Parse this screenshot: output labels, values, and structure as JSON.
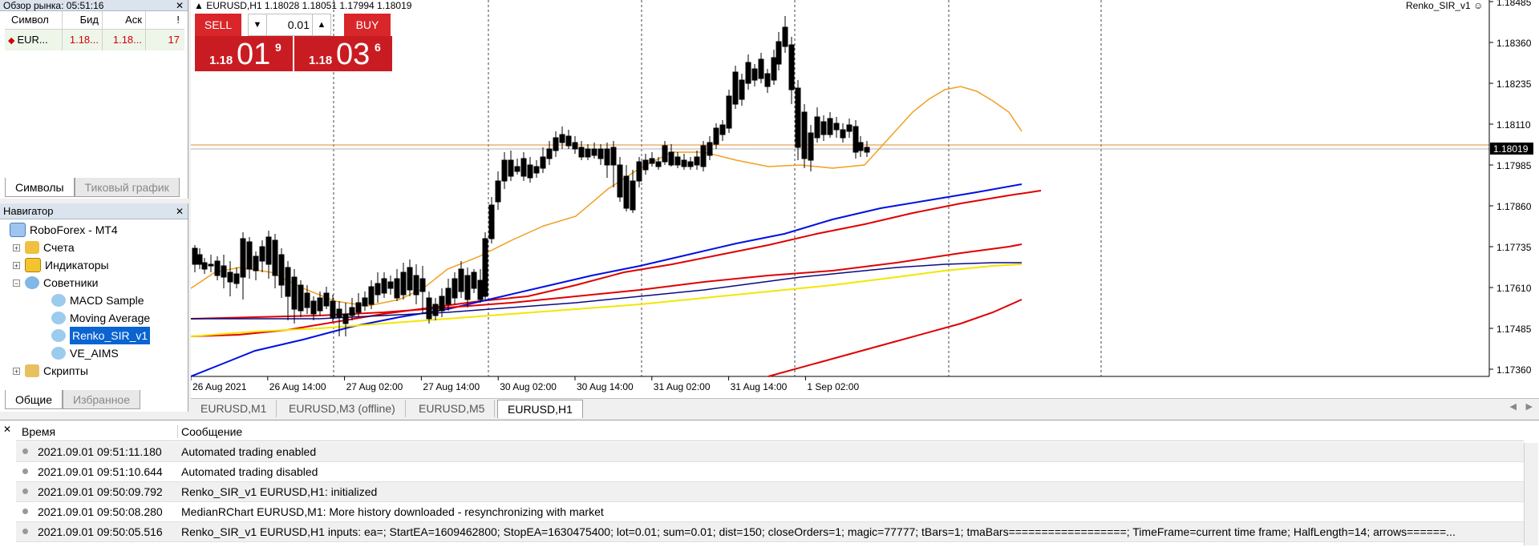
{
  "market_watch": {
    "title": "Обзор рынка: 05:51:16",
    "columns": [
      "Символ",
      "Бид",
      "Аск",
      "!"
    ],
    "rows": [
      {
        "symbol": "EUR...",
        "bid": "1.18...",
        "ask": "1.18...",
        "spread": "17"
      }
    ],
    "tabs": [
      "Символы",
      "Тиковый график"
    ]
  },
  "navigator": {
    "title": "Навигатор",
    "items": {
      "root": "RoboForex - MT4",
      "accounts": "Счета",
      "indicators": "Индикаторы",
      "experts": "Советники",
      "ea1": "MACD Sample",
      "ea2": "Moving Average",
      "ea3": "Renko_SIR_v1",
      "ea4": "VE_AIMS",
      "scripts": "Скрипты"
    },
    "tabs": [
      "Общие",
      "Избранное"
    ]
  },
  "chart": {
    "header": "EURUSD,H1  1.18028 1.18051 1.17994 1.18019",
    "ea_label": "Renko_SIR_v1",
    "trade": {
      "sell": "SELL",
      "buy": "BUY",
      "lot": "0.01",
      "sell_small": "1.18",
      "sell_big": "01",
      "sell_sup": "9",
      "buy_small": "1.18",
      "buy_big": "03",
      "buy_sup": "6"
    },
    "price_labels": [
      "1.18485",
      "1.18360",
      "1.18235",
      "1.18110",
      "1.17985",
      "1.17860",
      "1.17735",
      "1.17610",
      "1.17485",
      "1.17360"
    ],
    "current_price": "1.18019",
    "time_labels": [
      "26 Aug 2021",
      "26 Aug 14:00",
      "27 Aug 02:00",
      "27 Aug 14:00",
      "30 Aug 02:00",
      "30 Aug 14:00",
      "31 Aug 02:00",
      "31 Aug 14:00",
      "1 Sep 02:00"
    ],
    "tabs": [
      "EURUSD,M1",
      "EURUSD,M3 (offline)",
      "EURUSD,M5",
      "EURUSD,H1"
    ]
  },
  "journal": {
    "columns": [
      "Время",
      "Сообщение"
    ],
    "rows": [
      {
        "time": "2021.09.01 09:51:11.180",
        "msg": "Automated trading enabled"
      },
      {
        "time": "2021.09.01 09:51:10.644",
        "msg": "Automated trading disabled"
      },
      {
        "time": "2021.09.01 09:50:09.792",
        "msg": "Renko_SIR_v1 EURUSD,H1: initialized"
      },
      {
        "time": "2021.09.01 09:50:08.280",
        "msg": "MedianRChart EURUSD,M1: More history downloaded - resynchronizing with market"
      },
      {
        "time": "2021.09.01 09:50:05.516",
        "msg": "Renko_SIR_v1 EURUSD,H1 inputs: ea=; StartEA=1609462800; StopEA=1630475400; lot=0.01; sum=0.01; dist=150; closeOrders=1; magic=77777; tBars=1; tmaBars==================; TimeFrame=current time frame; HalfLength=14; arrows======..."
      }
    ]
  }
}
